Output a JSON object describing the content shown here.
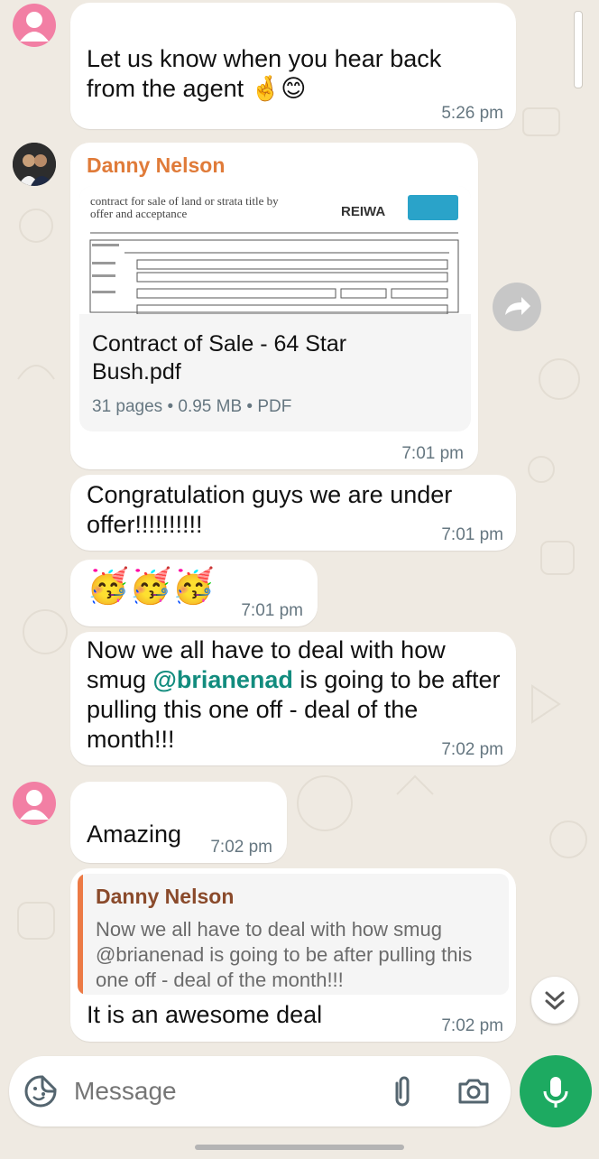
{
  "messages": {
    "m1": {
      "text": "Let us know when you hear back from the agent 🤞😊",
      "time": "5:26 pm"
    },
    "m2": {
      "sender": "Danny Nelson",
      "file_name": "Contract of Sale - 64 Star Bush.pdf",
      "file_meta": "31 pages • 0.95 MB • PDF",
      "preview_title": "contract for sale of land or strata title by offer and acceptance",
      "preview_brand": "REIWA",
      "time": "7:01 pm"
    },
    "m3": {
      "text": "Congratulation guys we are under offer!!!!!!!!!!",
      "time": "7:01 pm"
    },
    "m4": {
      "text": "🥳🥳🥳",
      "time": "7:01 pm"
    },
    "m5": {
      "text_before": "Now we all have to deal with how smug ",
      "mention": "@brianenad",
      "text_after": " is going to be after pulling this one off - deal of the month!!!",
      "time": "7:02 pm"
    },
    "m6": {
      "text": "Amazing",
      "time": "7:02 pm"
    },
    "m7": {
      "quote_sender": "Danny Nelson",
      "quote_text": "Now we all have to deal with how smug @brianenad is going to be after pulling this one off - deal of the month!!!",
      "text": "It is an awesome deal",
      "time": "7:02 pm"
    }
  },
  "composer": {
    "placeholder": "Message"
  },
  "colors": {
    "accent": "#1daa61",
    "sender_name": "#e07b39",
    "mention": "#128c7e",
    "avatar_pink": "#f27fa4",
    "quote_bar": "#ec7a45"
  },
  "icons": [
    "avatar-placeholder-icon",
    "forward-icon",
    "scroll-down-icon",
    "sticker-icon",
    "attach-icon",
    "camera-icon",
    "mic-icon"
  ]
}
